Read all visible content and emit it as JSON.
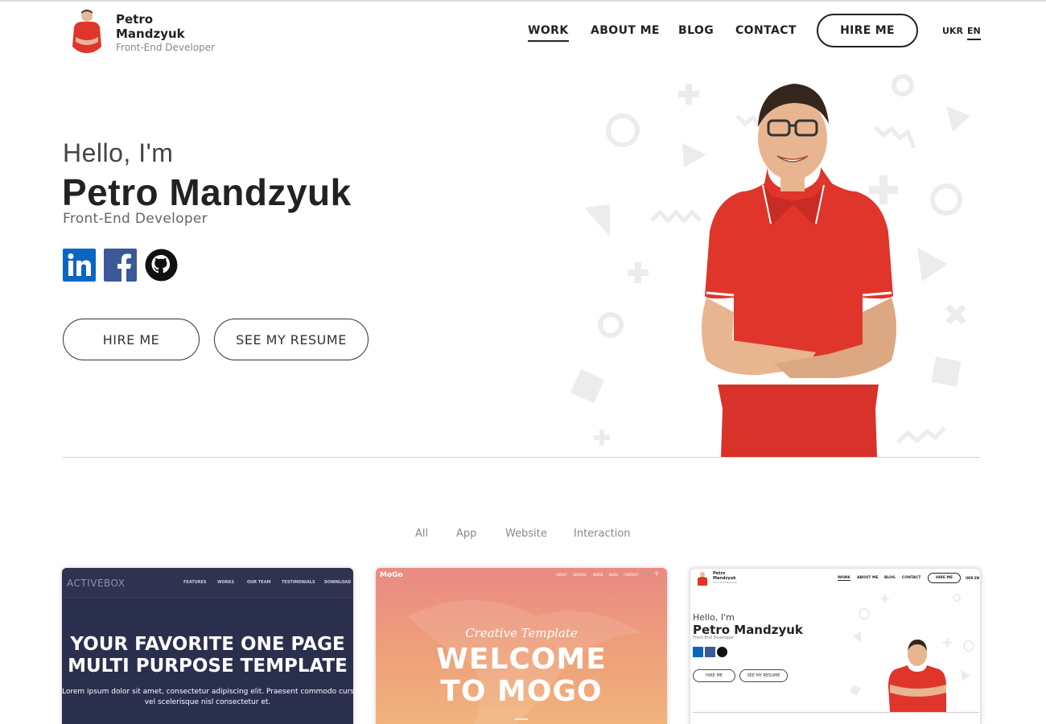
{
  "header": {
    "brand_name": "Petro Mandzyuk",
    "brand_subtitle": "Front-End Developer",
    "nav": [
      {
        "label": "WORK",
        "active": true
      },
      {
        "label": "ABOUT ME",
        "active": false
      },
      {
        "label": "BLOG",
        "active": false
      },
      {
        "label": "CONTACT",
        "active": false
      }
    ],
    "hire_label": "HIRE ME",
    "languages": [
      {
        "label": "UKR",
        "active": false
      },
      {
        "label": "EN",
        "active": true
      }
    ]
  },
  "hero": {
    "greeting": "Hello, I'm",
    "name": "Petro Mandzyuk",
    "role": "Front-End Developer",
    "socials": [
      {
        "icon": "linkedin-icon",
        "color": "#0a66c2"
      },
      {
        "icon": "facebook-icon",
        "color": "#3b5998"
      },
      {
        "icon": "github-icon",
        "color": "#111111"
      }
    ],
    "hire_label": "HIRE ME",
    "resume_label": "SEE MY RESUME",
    "shirt_color": "#e0352b"
  },
  "filters": [
    "All",
    "App",
    "Website",
    "Interaction"
  ],
  "projects": [
    {
      "logo": "ACTIVEBOX",
      "nav": [
        "FEATURES",
        "WORKS",
        "OUR TEAM",
        "TESTIMONIALS",
        "DOWNLOAD"
      ],
      "title_line1": "YOUR FAVORITE ONE PAGE",
      "title_line2": "MULTI PURPOSE TEMPLATE",
      "text_line1": "Lorem ipsum dolor sit amet, consectetur adipiscing elit. Praesent commodo cursus magna",
      "text_line2": "vel scelerisque nisl consectetur et."
    },
    {
      "logo": "MoGo",
      "nav": [
        "ABOUT",
        "SERVICE",
        "WORK",
        "BLOG",
        "CONTACT"
      ],
      "script": "Creative Template",
      "title_line1": "WELCOME",
      "title_line2": "TO MOGO"
    },
    {
      "brand_name_line1": "Petro",
      "brand_name_line2": "Mandzyuk",
      "brand_subtitle": "Front-End Developer",
      "nav": [
        "WORK",
        "ABOUT ME",
        "BLOG",
        "CONTACT"
      ],
      "hire_label": "HIRE ME",
      "languages": [
        "UKR",
        "EN"
      ],
      "greeting": "Hello, I'm",
      "name": "Petro Mandzyuk",
      "role": "Front-End Developer",
      "hire_button": "HIRE ME",
      "resume_button": "SEE MY RESUME"
    }
  ]
}
